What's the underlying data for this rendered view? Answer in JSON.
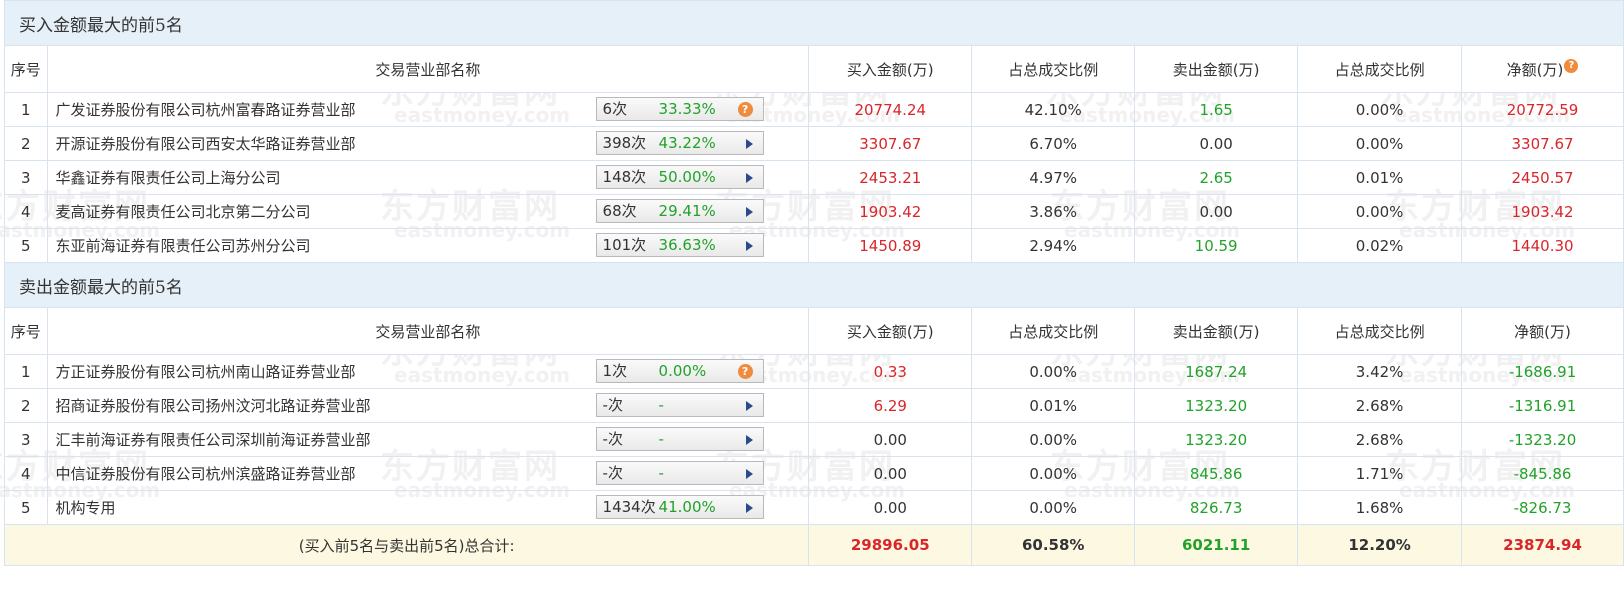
{
  "watermark": {
    "cn": "东方财富网",
    "en": "eastmoney.com"
  },
  "buy_section": {
    "title": "买入金额最大的前5名",
    "headers": [
      "序号",
      "交易营业部名称",
      "买入金额(万)",
      "占总成交比例",
      "卖出金额(万)",
      "占总成交比例",
      "净额(万)"
    ],
    "rows": [
      {
        "idx": "1",
        "name": "广发证券股份有限公司杭州富春路证券营业部",
        "times": "6次",
        "pct": "33.33%",
        "btn": "question",
        "buy": "20774.24",
        "buy_ratio": "42.10%",
        "sell": "1.65",
        "sell_ratio": "0.00%",
        "net": "20772.59"
      },
      {
        "idx": "2",
        "name": "开源证券股份有限公司西安太华路证券营业部",
        "times": "398次",
        "pct": "43.22%",
        "btn": "arrow",
        "buy": "3307.67",
        "buy_ratio": "6.70%",
        "sell": "0.00",
        "sell_ratio": "0.00%",
        "net": "3307.67"
      },
      {
        "idx": "3",
        "name": "华鑫证券有限责任公司上海分公司",
        "times": "148次",
        "pct": "50.00%",
        "btn": "arrow",
        "buy": "2453.21",
        "buy_ratio": "4.97%",
        "sell": "2.65",
        "sell_ratio": "0.01%",
        "net": "2450.57"
      },
      {
        "idx": "4",
        "name": "麦高证券有限责任公司北京第二分公司",
        "times": "68次",
        "pct": "29.41%",
        "btn": "arrow",
        "buy": "1903.42",
        "buy_ratio": "3.86%",
        "sell": "0.00",
        "sell_ratio": "0.00%",
        "net": "1903.42"
      },
      {
        "idx": "5",
        "name": "东亚前海证券有限责任公司苏州分公司",
        "times": "101次",
        "pct": "36.63%",
        "btn": "arrow",
        "buy": "1450.89",
        "buy_ratio": "2.94%",
        "sell": "10.59",
        "sell_ratio": "0.02%",
        "net": "1440.30"
      }
    ]
  },
  "sell_section": {
    "title": "卖出金额最大的前5名",
    "headers": [
      "序号",
      "交易营业部名称",
      "买入金额(万)",
      "占总成交比例",
      "卖出金额(万)",
      "占总成交比例",
      "净额(万)"
    ],
    "rows": [
      {
        "idx": "1",
        "name": "方正证券股份有限公司杭州南山路证券营业部",
        "times": "1次",
        "pct": "0.00%",
        "btn": "question",
        "buy": "0.33",
        "buy_ratio": "0.00%",
        "sell": "1687.24",
        "sell_ratio": "3.42%",
        "net": "-1686.91"
      },
      {
        "idx": "2",
        "name": "招商证券股份有限公司扬州汶河北路证券营业部",
        "times": "-次",
        "pct": "-",
        "btn": "arrow",
        "buy": "6.29",
        "buy_ratio": "0.01%",
        "sell": "1323.20",
        "sell_ratio": "2.68%",
        "net": "-1316.91"
      },
      {
        "idx": "3",
        "name": "汇丰前海证券有限责任公司深圳前海证券营业部",
        "times": "-次",
        "pct": "-",
        "btn": "arrow",
        "buy": "0.00",
        "buy_ratio": "0.00%",
        "sell": "1323.20",
        "sell_ratio": "2.68%",
        "net": "-1323.20"
      },
      {
        "idx": "4",
        "name": "中信证券股份有限公司杭州滨盛路证券营业部",
        "times": "-次",
        "pct": "-",
        "btn": "arrow",
        "buy": "0.00",
        "buy_ratio": "0.00%",
        "sell": "845.86",
        "sell_ratio": "1.71%",
        "net": "-845.86"
      },
      {
        "idx": "5",
        "name": "机构专用",
        "times": "1434次",
        "pct": "41.00%",
        "btn": "arrow",
        "buy": "0.00",
        "buy_ratio": "0.00%",
        "sell": "826.73",
        "sell_ratio": "1.68%",
        "net": "-826.73"
      }
    ]
  },
  "total": {
    "label": "(买入前5名与卖出前5名)总合计:",
    "buy": "29896.05",
    "buy_ratio": "60.58%",
    "sell": "6021.11",
    "sell_ratio": "12.20%",
    "net": "23874.94"
  },
  "colors": {
    "positive": "#d8262a",
    "negative": "#22a22a",
    "section_bg": "#e6f0f9",
    "total_bg": "#fdf8e1",
    "help_icon": "#f08a3c"
  }
}
